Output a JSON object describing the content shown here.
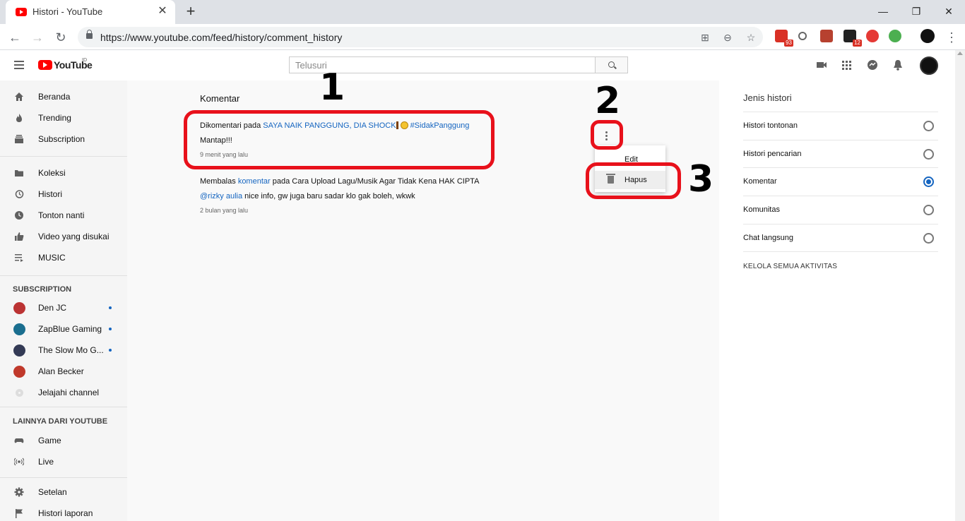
{
  "browser": {
    "tab_title": "Histori - YouTube",
    "url": "https://www.youtube.com/feed/history/comment_history",
    "ext_badge_1": "93",
    "ext_badge_2": "12"
  },
  "masthead": {
    "logo_text": "YouTube",
    "country_code": "ID",
    "search_placeholder": "Telusuri"
  },
  "sidebar": {
    "main_items": [
      {
        "label": "Beranda",
        "icon": "home-icon"
      },
      {
        "label": "Trending",
        "icon": "flame-icon"
      },
      {
        "label": "Subscription",
        "icon": "subscriptions-icon"
      }
    ],
    "library_items": [
      {
        "label": "Koleksi",
        "icon": "folder-icon"
      },
      {
        "label": "Histori",
        "icon": "history-icon"
      },
      {
        "label": "Tonton nanti",
        "icon": "clock-icon"
      },
      {
        "label": "Video yang disukai",
        "icon": "thumb-up-icon"
      },
      {
        "label": "MUSIC",
        "icon": "playlist-icon"
      }
    ],
    "subscription_header": "SUBSCRIPTION",
    "subscriptions": [
      {
        "label": "Den JC",
        "color": "#b33"
      },
      {
        "label": "ZapBlue Gaming",
        "color": "#1a6e8f"
      },
      {
        "label": "The Slow Mo G...",
        "color": "#333a55"
      },
      {
        "label": "Alan Becker",
        "color": "#c0392b"
      },
      {
        "label": "Jelajahi channel",
        "color": "#cccccc"
      }
    ],
    "more_header": "LAINNYA DARI YOUTUBE",
    "more_items": [
      {
        "label": "Game",
        "icon": "gamepad-icon"
      },
      {
        "label": "Live",
        "icon": "live-icon"
      }
    ],
    "bottom_items": [
      {
        "label": "Setelan",
        "icon": "gear-icon"
      },
      {
        "label": "Histori laporan",
        "icon": "flag-icon"
      }
    ]
  },
  "main": {
    "title": "Komentar",
    "comments": [
      {
        "prefix": "Dikomentari",
        "mid": " pada ",
        "video_link": "SAYA NAIK PANGGUNG, DIA SHOCK",
        "hashtag": "#SidakPanggung",
        "text": "Mantap!!!",
        "time": "9 menit yang lalu"
      },
      {
        "prefix": "Membalas",
        "link": "komentar",
        "mid": " pada ",
        "video": "Cara Upload Lagu/Musik Agar Tidak Kena HAK CIPTA",
        "mention": "@rizky aulia",
        "text": " nice info, gw juga baru sadar klo gak boleh, wkwk",
        "time": "2 bulan yang lalu"
      }
    ],
    "menu": {
      "edit": "Edit",
      "delete": "Hapus"
    },
    "annotations": [
      "1",
      "2",
      "3"
    ]
  },
  "history_panel": {
    "title": "Jenis histori",
    "options": [
      {
        "label": "Histori tontonan",
        "selected": false
      },
      {
        "label": "Histori pencarian",
        "selected": false
      },
      {
        "label": "Komentar",
        "selected": true
      },
      {
        "label": "Komunitas",
        "selected": false
      },
      {
        "label": "Chat langsung",
        "selected": false
      }
    ],
    "manage_label": "KELOLA SEMUA AKTIVITAS"
  },
  "colors": {
    "accent": "#1565c0",
    "youtube_red": "#ff0000",
    "annotation_red": "#e8111b"
  }
}
